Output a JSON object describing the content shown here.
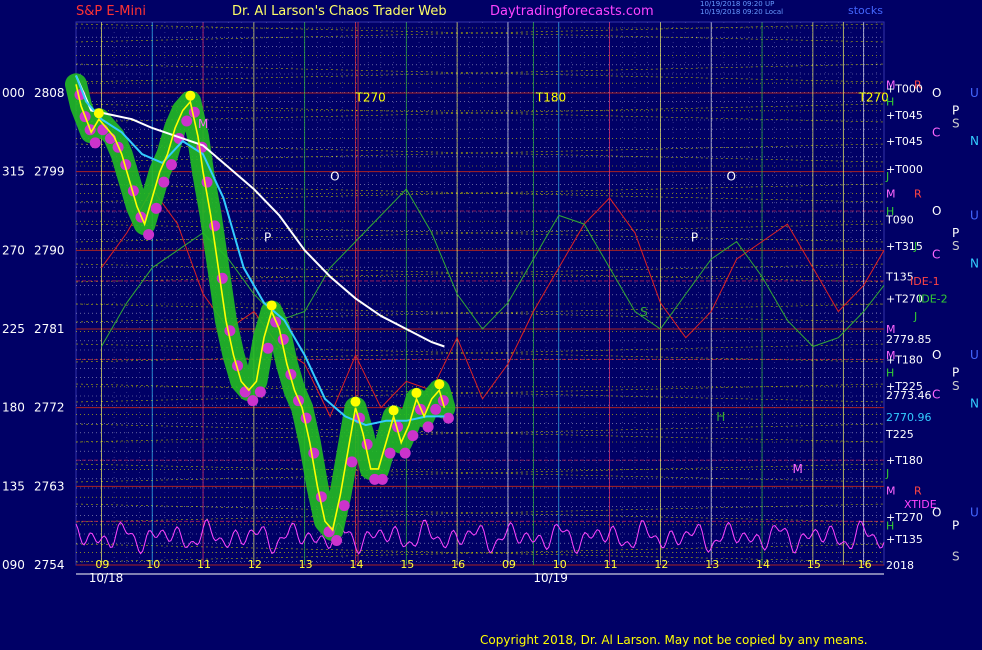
{
  "header": {
    "symbol": "S&P E-Mini",
    "title": "Dr. Al Larson's Chaos Trader Web",
    "site": "Daytradingforecasts.com",
    "stamp1": "10/19/2018 09:20 UP",
    "stamp2": "10/19/2018 09:20 Local",
    "corner": "stocks"
  },
  "footer": {
    "copyright": "Copyright 2018, Dr. Al Larson. May not be copied by any means."
  },
  "colors": {
    "background": "#000066",
    "price": "#ffff00",
    "slow_average": "#ffffff",
    "fast_average": "#33ccff",
    "glow": "#22bb22",
    "fast_marker": "#cc33cc",
    "red_cycle": "#dd2222",
    "green_cycle": "#33aa33",
    "pink_cycle": "#ff44ff"
  },
  "chart_data": {
    "type": "line",
    "title": "",
    "xlabel": "",
    "ylabel": "",
    "ylim": [
      2754,
      2810.6
    ],
    "y_ticks": [
      {
        "value": 2808,
        "left": "000",
        "right": "2808"
      },
      {
        "value": 2799,
        "left": "315",
        "right": "2799"
      },
      {
        "value": 2790,
        "left": "270",
        "right": "2790"
      },
      {
        "value": 2781,
        "left": "225",
        "right": "2781"
      },
      {
        "value": 2772,
        "left": "180",
        "right": "2772"
      },
      {
        "value": 2763,
        "left": "135",
        "right": "2763"
      },
      {
        "value": 2754,
        "left": "090",
        "right": "2754"
      }
    ],
    "x_ticks": [
      {
        "x": 8,
        "label": "09"
      },
      {
        "x": 9,
        "label": "10"
      },
      {
        "x": 10,
        "label": "11"
      },
      {
        "x": 11,
        "label": "12"
      },
      {
        "x": 12,
        "label": "13"
      },
      {
        "x": 13,
        "label": "14"
      },
      {
        "x": 14,
        "label": "15"
      },
      {
        "x": 15,
        "label": "16"
      },
      {
        "x": 16,
        "label": "09"
      },
      {
        "x": 17,
        "label": "10"
      },
      {
        "x": 18,
        "label": "11"
      },
      {
        "x": 19,
        "label": "12"
      },
      {
        "x": 20,
        "label": "13"
      },
      {
        "x": 21,
        "label": "14"
      },
      {
        "x": 22,
        "label": "15"
      },
      {
        "x": 23,
        "label": "16"
      }
    ],
    "date_labels": [
      {
        "x": 7.75,
        "label": "10/18"
      },
      {
        "x": 16.5,
        "label": "10/19"
      }
    ],
    "xlim": [
      7.5,
      23.4
    ],
    "series": [
      {
        "key": "price",
        "values": [
          [
            7.5,
            2809
          ],
          [
            7.6,
            2806.5
          ],
          [
            7.7,
            2805
          ],
          [
            7.8,
            2803.5
          ],
          [
            7.95,
            2805
          ],
          [
            8.1,
            2804
          ],
          [
            8.25,
            2803
          ],
          [
            8.4,
            2801
          ],
          [
            8.55,
            2798
          ],
          [
            8.7,
            2795
          ],
          [
            8.85,
            2793
          ],
          [
            9.0,
            2796
          ],
          [
            9.15,
            2799
          ],
          [
            9.3,
            2801
          ],
          [
            9.45,
            2804
          ],
          [
            9.6,
            2806
          ],
          [
            9.75,
            2807
          ],
          [
            9.9,
            2803
          ],
          [
            10.0,
            2799
          ],
          [
            10.15,
            2794
          ],
          [
            10.3,
            2788
          ],
          [
            10.45,
            2782
          ],
          [
            10.6,
            2778
          ],
          [
            10.75,
            2775
          ],
          [
            10.9,
            2774
          ],
          [
            11.05,
            2775
          ],
          [
            11.2,
            2780
          ],
          [
            11.35,
            2783
          ],
          [
            11.5,
            2781
          ],
          [
            11.65,
            2777
          ],
          [
            11.8,
            2774
          ],
          [
            11.95,
            2772
          ],
          [
            12.1,
            2768
          ],
          [
            12.25,
            2763
          ],
          [
            12.4,
            2759
          ],
          [
            12.55,
            2758
          ],
          [
            12.7,
            2762
          ],
          [
            12.85,
            2767
          ],
          [
            13.0,
            2772
          ],
          [
            13.15,
            2769
          ],
          [
            13.3,
            2765
          ],
          [
            13.45,
            2765
          ],
          [
            13.6,
            2768
          ],
          [
            13.75,
            2771
          ],
          [
            13.9,
            2768
          ],
          [
            14.05,
            2770
          ],
          [
            14.2,
            2773
          ],
          [
            14.35,
            2771
          ],
          [
            14.5,
            2773
          ],
          [
            14.65,
            2774
          ],
          [
            14.75,
            2772
          ]
        ]
      },
      {
        "key": "slow_average",
        "values": [
          [
            7.5,
            2810
          ],
          [
            7.8,
            2806
          ],
          [
            8.2,
            2805.5
          ],
          [
            8.6,
            2805
          ],
          [
            9.0,
            2804
          ],
          [
            9.5,
            2803
          ],
          [
            10.0,
            2802
          ],
          [
            10.5,
            2799.5
          ],
          [
            11.0,
            2797
          ],
          [
            11.5,
            2794
          ],
          [
            12.0,
            2790
          ],
          [
            12.5,
            2787
          ],
          [
            13.0,
            2784.5
          ],
          [
            13.5,
            2782.5
          ],
          [
            14.0,
            2781
          ],
          [
            14.5,
            2779.5
          ],
          [
            14.75,
            2779
          ]
        ]
      },
      {
        "key": "fast_average",
        "values": [
          [
            7.5,
            2810
          ],
          [
            7.7,
            2807
          ],
          [
            8.0,
            2805
          ],
          [
            8.4,
            2803.5
          ],
          [
            8.8,
            2801
          ],
          [
            9.2,
            2800
          ],
          [
            9.6,
            2802.5
          ],
          [
            10.0,
            2801
          ],
          [
            10.4,
            2796
          ],
          [
            10.8,
            2788
          ],
          [
            11.2,
            2784
          ],
          [
            11.6,
            2782
          ],
          [
            12.0,
            2778
          ],
          [
            12.4,
            2773
          ],
          [
            12.8,
            2771
          ],
          [
            13.2,
            2770
          ],
          [
            13.6,
            2770.5
          ],
          [
            14.0,
            2770.5
          ],
          [
            14.4,
            2771
          ],
          [
            14.75,
            2771
          ]
        ]
      },
      {
        "key": "red_cycle",
        "values": [
          [
            8.0,
            2788
          ],
          [
            8.5,
            2792
          ],
          [
            9.0,
            2797
          ],
          [
            9.5,
            2793
          ],
          [
            10.0,
            2785
          ],
          [
            10.5,
            2781
          ],
          [
            11.0,
            2783
          ],
          [
            11.5,
            2779
          ],
          [
            12.0,
            2777
          ],
          [
            12.5,
            2771
          ],
          [
            13.0,
            2778
          ],
          [
            13.5,
            2772
          ],
          [
            14.0,
            2775
          ],
          [
            14.5,
            2774
          ],
          [
            15.0,
            2780
          ],
          [
            15.5,
            2773
          ],
          [
            16.0,
            2777
          ],
          [
            16.5,
            2783
          ],
          [
            17.0,
            2788
          ],
          [
            17.5,
            2793
          ],
          [
            18.0,
            2796
          ],
          [
            18.5,
            2792
          ],
          [
            19.0,
            2784
          ],
          [
            19.5,
            2780
          ],
          [
            20.0,
            2783
          ],
          [
            20.5,
            2789
          ],
          [
            21.0,
            2791
          ],
          [
            21.5,
            2793
          ],
          [
            22.0,
            2788
          ],
          [
            22.5,
            2783
          ],
          [
            23.0,
            2786
          ],
          [
            23.4,
            2790
          ]
        ]
      },
      {
        "key": "green_cycle",
        "values": [
          [
            8.0,
            2779
          ],
          [
            8.5,
            2784
          ],
          [
            9.0,
            2788
          ],
          [
            9.5,
            2790
          ],
          [
            10.0,
            2792
          ],
          [
            10.5,
            2789
          ],
          [
            11.0,
            2785
          ],
          [
            11.5,
            2782
          ],
          [
            12.0,
            2783
          ],
          [
            12.5,
            2788
          ],
          [
            13.0,
            2791
          ],
          [
            13.5,
            2794
          ],
          [
            14.0,
            2797
          ],
          [
            14.5,
            2792
          ],
          [
            15.0,
            2785
          ],
          [
            15.5,
            2781
          ],
          [
            16.0,
            2784
          ],
          [
            16.5,
            2789
          ],
          [
            17.0,
            2794
          ],
          [
            17.5,
            2793
          ],
          [
            18.0,
            2788
          ],
          [
            18.5,
            2783
          ],
          [
            19.0,
            2781
          ],
          [
            19.5,
            2785
          ],
          [
            20.0,
            2789
          ],
          [
            20.5,
            2791
          ],
          [
            21.0,
            2787
          ],
          [
            21.5,
            2782
          ],
          [
            22.0,
            2779
          ],
          [
            22.5,
            2780
          ],
          [
            23.0,
            2783
          ],
          [
            23.4,
            2786
          ]
        ]
      }
    ],
    "text_annotations": [
      {
        "x": 9.9,
        "y": 2804,
        "text": "M",
        "color": "#ff66ff"
      },
      {
        "x": 12.5,
        "y": 2798,
        "text": "O",
        "color": "#ffffff"
      },
      {
        "x": 11.2,
        "y": 2791,
        "text": "P",
        "color": "#ffffff"
      },
      {
        "x": 13.0,
        "y": 2807,
        "text": "T270",
        "color": "#ffff00"
      },
      {
        "x": 16.55,
        "y": 2807,
        "text": "T180",
        "color": "#ffff00"
      },
      {
        "x": 20.3,
        "y": 2798,
        "text": "O",
        "color": "#ffffff"
      },
      {
        "x": 19.6,
        "y": 2791,
        "text": "P",
        "color": "#ffffff"
      },
      {
        "x": 18.6,
        "y": 2782.5,
        "text": "S",
        "color": "#33aa33"
      },
      {
        "x": 22.9,
        "y": 2807,
        "text": "T270",
        "color": "#ffff00"
      },
      {
        "x": 21.6,
        "y": 2764.5,
        "text": "M",
        "color": "#ff66ff"
      },
      {
        "x": 20.1,
        "y": 2770.5,
        "text": "H",
        "color": "#33aa33"
      }
    ],
    "right_labels": [
      {
        "y": 2809,
        "text": "M",
        "color": "#ff66ff"
      },
      {
        "y": 2809,
        "text": "R",
        "color": "#ff4444",
        "dx": 28
      },
      {
        "y": 2807,
        "text": "H",
        "color": "#33cc33"
      },
      {
        "y": 2808.5,
        "text": "+T000",
        "color": "#ffffff"
      },
      {
        "y": 2805.5,
        "text": "+T045",
        "color": "#ffffff"
      },
      {
        "y": 2802.5,
        "text": "+T045",
        "color": "#ffffff"
      },
      {
        "y": 2799.3,
        "text": "+T000",
        "color": "#ffffff"
      },
      {
        "y": 2798.5,
        "text": "J",
        "color": "#33cc33"
      },
      {
        "y": 2796.5,
        "text": "M",
        "color": "#ff66ff"
      },
      {
        "y": 2796.5,
        "text": "R",
        "color": "#ff4444",
        "dx": 28
      },
      {
        "y": 2794.5,
        "text": "H",
        "color": "#33cc33"
      },
      {
        "y": 2793.5,
        "text": "T090",
        "color": "#ffffff"
      },
      {
        "y": 2790.5,
        "text": "+T315",
        "color": "#ffffff"
      },
      {
        "y": 2790.5,
        "text": "J",
        "color": "#33cc33",
        "dx": 28
      },
      {
        "y": 2787,
        "text": "T135",
        "color": "#ffffff"
      },
      {
        "y": 2786.5,
        "text": "IDE-1",
        "color": "#ff4444",
        "dx": 24
      },
      {
        "y": 2784.5,
        "text": "+T270",
        "color": "#ffffff"
      },
      {
        "y": 2784.5,
        "text": "IDE-2",
        "color": "#33cc33",
        "dx": 32
      },
      {
        "y": 2782.5,
        "text": "J",
        "color": "#33cc33",
        "dx": 28
      },
      {
        "y": 2781,
        "text": "M",
        "color": "#ff66ff"
      },
      {
        "y": 2779.85,
        "text": "2779.85",
        "color": "#ffffff"
      },
      {
        "y": 2778,
        "text": "M",
        "color": "#ff66ff"
      },
      {
        "y": 2777.5,
        "text": "+T180",
        "color": "#ffffff"
      },
      {
        "y": 2776,
        "text": "H",
        "color": "#33cc33"
      },
      {
        "y": 2774.5,
        "text": "+T225",
        "color": "#ffffff"
      },
      {
        "y": 2773.46,
        "text": "2773.46",
        "color": "#ffffff"
      },
      {
        "y": 2770.96,
        "text": "2770.96",
        "color": "#33ccff"
      },
      {
        "y": 2769,
        "text": "T225",
        "color": "#ffffff"
      },
      {
        "y": 2766,
        "text": "+T180",
        "color": "#ffffff"
      },
      {
        "y": 2764.5,
        "text": "J",
        "color": "#33cc33"
      },
      {
        "y": 2762.5,
        "text": "M",
        "color": "#ff66ff"
      },
      {
        "y": 2762.5,
        "text": "R",
        "color": "#ff4444",
        "dx": 28
      },
      {
        "y": 2761,
        "text": "XTIDE",
        "color": "#ff44ff",
        "dx": 18
      },
      {
        "y": 2759.5,
        "text": "+T270",
        "color": "#ffffff"
      },
      {
        "y": 2758.5,
        "text": "H",
        "color": "#33cc33"
      },
      {
        "y": 2757,
        "text": "+T135",
        "color": "#ffffff"
      },
      {
        "y": 2754,
        "text": "2018",
        "color": "#ffffff"
      }
    ],
    "planet_labels": [
      {
        "y": 2808,
        "text": "O",
        "color": "#ffffff",
        "col": 0
      },
      {
        "y": 2808,
        "text": "U",
        "color": "#4466ff",
        "col": 2
      },
      {
        "y": 2806,
        "text": "P",
        "color": "#ffffff",
        "col": 1
      },
      {
        "y": 2804.5,
        "text": "S",
        "color": "#cccccc",
        "col": 1
      },
      {
        "y": 2803.5,
        "text": "C",
        "color": "#ff66ff",
        "col": 0
      },
      {
        "y": 2802.5,
        "text": "N",
        "color": "#33ccff",
        "col": 2
      },
      {
        "y": 2794.5,
        "text": "O",
        "color": "#ffffff",
        "col": 0
      },
      {
        "y": 2794,
        "text": "U",
        "color": "#4466ff",
        "col": 2
      },
      {
        "y": 2792,
        "text": "P",
        "color": "#ffffff",
        "col": 1
      },
      {
        "y": 2790.5,
        "text": "S",
        "color": "#cccccc",
        "col": 1
      },
      {
        "y": 2789.5,
        "text": "C",
        "color": "#ff66ff",
        "col": 0
      },
      {
        "y": 2788.5,
        "text": "N",
        "color": "#33ccff",
        "col": 2
      },
      {
        "y": 2778,
        "text": "O",
        "color": "#ffffff",
        "col": 0
      },
      {
        "y": 2778,
        "text": "U",
        "color": "#4466ff",
        "col": 2
      },
      {
        "y": 2776,
        "text": "P",
        "color": "#ffffff",
        "col": 1
      },
      {
        "y": 2774.5,
        "text": "S",
        "color": "#cccccc",
        "col": 1
      },
      {
        "y": 2773.5,
        "text": "C",
        "color": "#ff66ff",
        "col": 0
      },
      {
        "y": 2772.5,
        "text": "N",
        "color": "#33ccff",
        "col": 2
      },
      {
        "y": 2760,
        "text": "O",
        "color": "#ffffff",
        "col": 0
      },
      {
        "y": 2760,
        "text": "U",
        "color": "#4466ff",
        "col": 2
      },
      {
        "y": 2758.5,
        "text": "P",
        "color": "#ffffff",
        "col": 1
      },
      {
        "y": 2755,
        "text": "S",
        "color": "#cccccc",
        "col": 1
      }
    ],
    "grid": true
  }
}
